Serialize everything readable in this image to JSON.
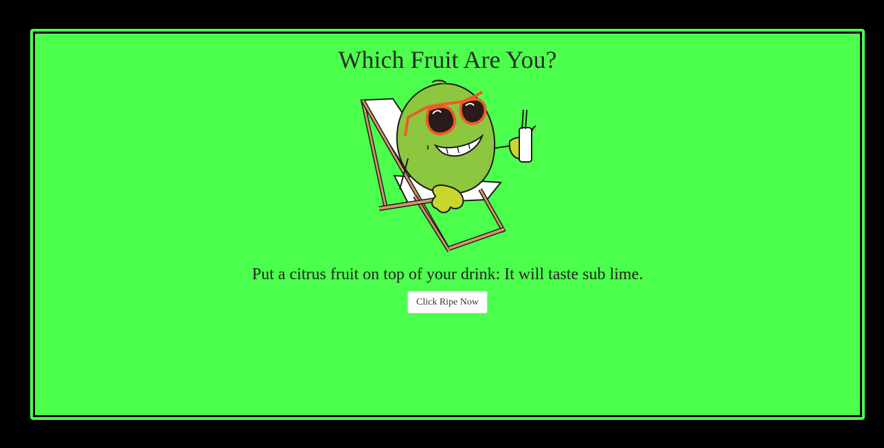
{
  "page": {
    "title": "Which Fruit Are You?",
    "joke": "Put a citrus fruit on top of your drink: It will taste sub lime.",
    "button_label": "Click Ripe Now",
    "illustration": "lime-in-beach-chair-with-sunglasses-icon"
  },
  "colors": {
    "background": "#000000",
    "panel": "#4dff4d",
    "lime": "#8dc63f",
    "sunglasses_frame": "#f05a28",
    "chair_wood": "#d4956a"
  }
}
